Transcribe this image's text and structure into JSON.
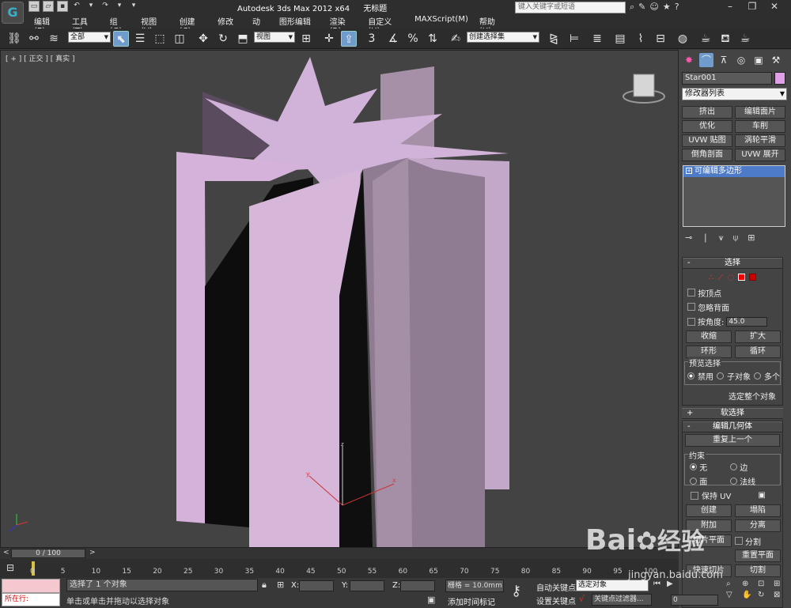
{
  "app": {
    "title_left": "Autodesk 3ds Max  2012 x64",
    "title_right": "无标题",
    "logo": "G",
    "search_placeholder": "键入关键字或短语"
  },
  "menu": [
    "编辑(E)",
    "工具(T)",
    "组(G)",
    "视图(V)",
    "创建(C)",
    "修改器",
    "动画",
    "图形编辑器",
    "渲染(R)",
    "自定义(U)",
    "MAXScript(M)",
    "帮助(H)"
  ],
  "toolbar": {
    "filter_select": "全部",
    "refcoord_select": "视图",
    "named_selection": "创建选择集",
    "snap_label": "3"
  },
  "viewport": {
    "label": "[ + ] [ 正交 ] [ 真实 ]",
    "axis_x": "x",
    "axis_y": "y",
    "axis_z": "z",
    "object_color": "#d4b0d8",
    "background": "#434343"
  },
  "command_panel": {
    "object_name": "Star001",
    "object_color": "#e0a0e8",
    "modifier_list": "修改器列表",
    "modifier_buttons": [
      "挤出",
      "编辑面片",
      "优化",
      "车削",
      "UVW 贴图",
      "涡轮平滑",
      "倒角剖面",
      "UVW 展开"
    ],
    "stack_item": "可编辑多边形",
    "selection": {
      "title": "选择",
      "by_vertex": "按顶点",
      "ignore_backfacing": "忽略背面",
      "by_angle": "按角度:",
      "angle_value": "45.0",
      "shrink": "收缩",
      "grow": "扩大",
      "ring": "环形",
      "loop": "循环",
      "preview_group": "预览选择",
      "preview_off": "禁用",
      "preview_subobj": "子对象",
      "preview_multi": "多个",
      "summary": "选定整个对象"
    },
    "soft_selection": "软选择",
    "edit_geometry": {
      "title": "编辑几何体",
      "repeat_last": "重复上一个",
      "constraints_group": "约束",
      "none": "无",
      "edge": "边",
      "face": "面",
      "normal": "法线",
      "preserve_uv": "保持 UV",
      "create": "创建",
      "collapse": "塌陷",
      "attach": "附加",
      "detach": "分离",
      "slice_plane": "切片平面",
      "split": "分割",
      "reset_plane": "重置平面",
      "quick_slice": "快速切片",
      "cut": "切割"
    }
  },
  "timeline": {
    "frame_display": "0 / 100",
    "ticks": [
      "0",
      "5",
      "10",
      "15",
      "20",
      "25",
      "30",
      "35",
      "40",
      "45",
      "50",
      "55",
      "60",
      "65",
      "70",
      "75",
      "80",
      "85",
      "90",
      "95",
      "100"
    ]
  },
  "status": {
    "script_listener": "所在行:",
    "selection_info": "选择了 1 个对象",
    "prompt": "单击或单击并拖动以选择对象",
    "x_label": "X:",
    "y_label": "Y:",
    "z_label": "Z:",
    "grid": "栅格 = 10.0mm",
    "add_time_tag": "添加时间标记",
    "auto_key": "自动关键点",
    "set_key": "设置关键点",
    "selected_set": "选定对象",
    "key_filters": "关键点过滤器...",
    "frame_field": "0"
  },
  "watermark": {
    "brand": "Bai",
    "brand2": "经验",
    "url": "jingyan.baidu.com"
  }
}
